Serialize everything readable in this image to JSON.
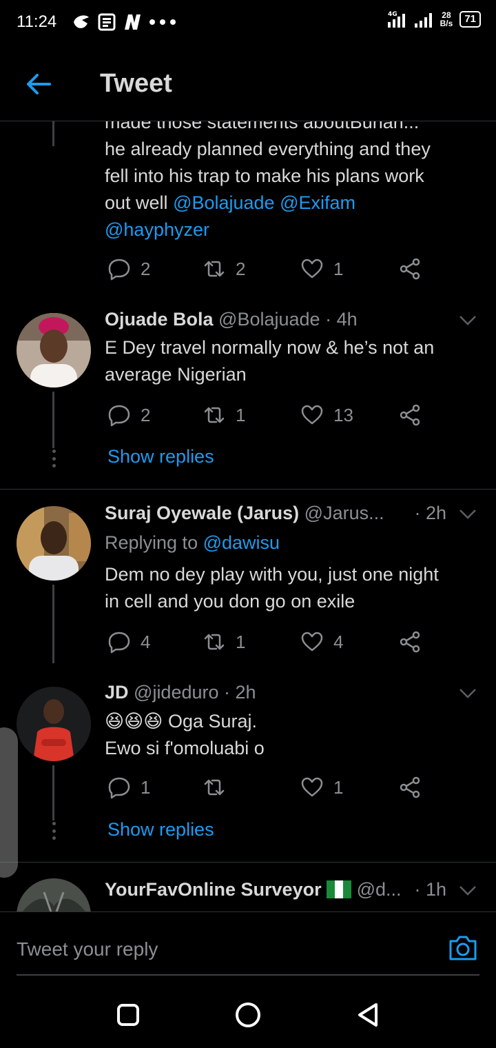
{
  "status_bar": {
    "time": "11:24",
    "network": "4G",
    "speed_value": "28",
    "speed_unit": "B/s",
    "battery": "71"
  },
  "header": {
    "title": "Tweet"
  },
  "tweets": [
    {
      "partial_top_line": "made those statements aboutBuhari...",
      "text_lines": [
        "he already planned everything and they",
        "fell into his trap to make his plans work"
      ],
      "line3_prefix": "out well ",
      "mentions_line3": [
        "@Bolajuade",
        "@Exifam"
      ],
      "mention_line4": "@hayphyzer",
      "replies": "2",
      "retweets": "2",
      "likes": "1"
    },
    {
      "name": "Ojuade  Bola",
      "handle": "@Bolajuade",
      "time": "· 4h",
      "text_lines": [
        "E Dey travel normally now & he’s not an",
        "average Nigerian"
      ],
      "replies": "2",
      "retweets": "1",
      "likes": "13",
      "show_replies": "Show replies"
    },
    {
      "name": "Suraj Oyewale (Jarus)",
      "handle": "@Jarus...",
      "time": "· 2h",
      "replying_label": "Replying to ",
      "replying_to": "@dawisu",
      "text_lines": [
        "Dem no dey play with you, just one night",
        "in cell and you don go on exile"
      ],
      "replies": "4",
      "retweets": "1",
      "likes": "4"
    },
    {
      "name": "JD",
      "handle": "@jideduro",
      "time": "· 2h",
      "emoji": "😆😆😆",
      "text_lines": [
        "Oga Suraj.",
        "Ewo si f'omoluabi o"
      ],
      "replies": "1",
      "retweets": "",
      "likes": "1",
      "show_replies": "Show replies"
    },
    {
      "name": "YourFavOnline Surveyor",
      "handle": "@d...",
      "time": "· 1h"
    }
  ],
  "composer": {
    "placeholder": "Tweet your reply"
  },
  "colors": {
    "accent": "#1d9bf0",
    "muted": "#8b8f93",
    "background": "#000000"
  }
}
